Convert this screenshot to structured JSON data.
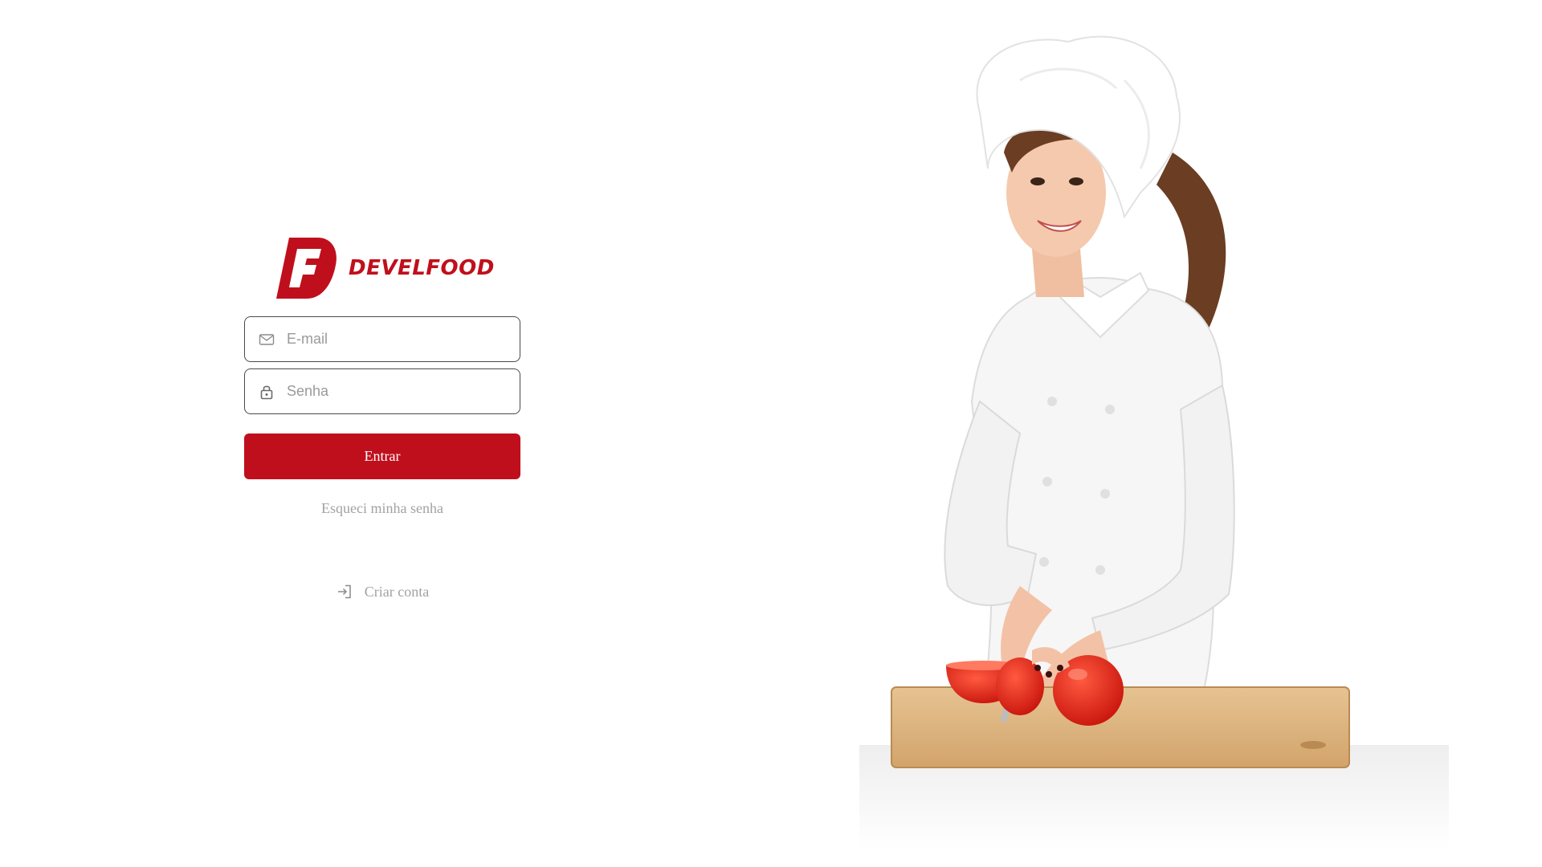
{
  "brand": {
    "letter": "F",
    "name": "DEVELFOOD",
    "color": "#c00f1c"
  },
  "login": {
    "email": {
      "placeholder": "E-mail",
      "value": "",
      "icon": "mail-icon"
    },
    "password": {
      "placeholder": "Senha",
      "value": "",
      "icon": "lock-icon"
    },
    "submit_label": "Entrar",
    "forgot_label": "Esqueci minha senha",
    "create_label": "Criar conta",
    "create_icon": "sign-in-arrow-icon"
  },
  "colors": {
    "accent": "#c00f1c",
    "input_border": "#4a4a4a",
    "muted_text": "#a2a2a2",
    "background": "#ffffff"
  }
}
